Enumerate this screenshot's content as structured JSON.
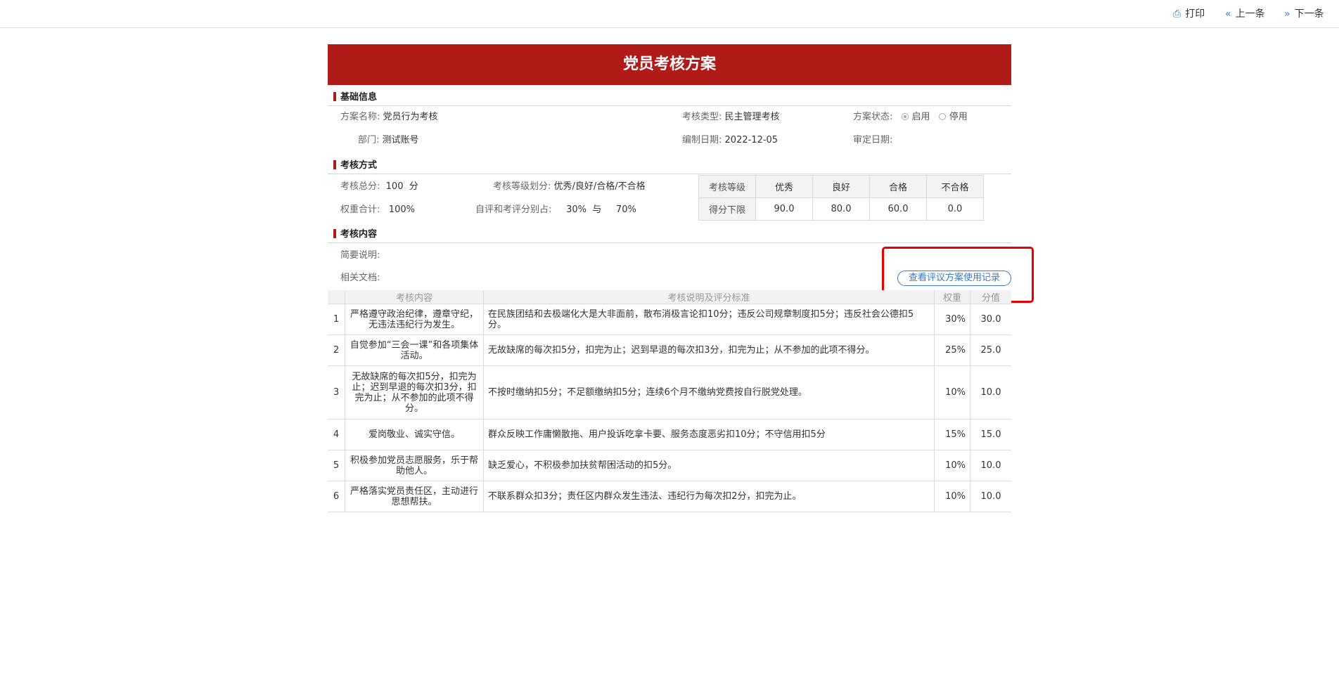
{
  "toolbar": {
    "print_label": "打印",
    "prev_label": "上一条",
    "next_label": "下一条"
  },
  "page": {
    "title": "党员考核方案"
  },
  "basic_info": {
    "section_title": "基础信息",
    "plan_name_label": "方案名称:",
    "plan_name": "党员行为考核",
    "assess_type_label": "考核类型:",
    "assess_type": "民主管理考核",
    "status_label": "方案状态:",
    "status_options": [
      "启用",
      "停用"
    ],
    "status_selected": "启用",
    "dept_label": "部门:",
    "dept": "测试账号",
    "compile_date_label": "编制日期:",
    "compile_date": "2022-12-05",
    "approve_date_label": "审定日期:",
    "approve_date": ""
  },
  "method": {
    "section_title": "考核方式",
    "total_label": "考核总分:",
    "total_value": "100",
    "total_unit": "分",
    "grade_split_label": "考核等级划分:",
    "grade_split": "优秀/良好/合格/不合格",
    "weight_sum_label": "权重合计:",
    "weight_sum": "100%",
    "ratio_label": "自评和考评分别占:",
    "self_ratio": "30%",
    "ratio_join": "与",
    "other_ratio": "70%",
    "grade_table": {
      "header_label": "考核等级",
      "grades": [
        "优秀",
        "良好",
        "合格",
        "不合格"
      ],
      "row_label": "得分下限",
      "thresholds": [
        "90.0",
        "80.0",
        "60.0",
        "0.0"
      ]
    }
  },
  "content": {
    "section_title": "考核内容",
    "summary_label": "简要说明:",
    "summary": "",
    "docs_label": "相关文档:",
    "record_button": "查看评议方案使用记录",
    "columns": [
      "",
      "考核内容",
      "考核说明及评分标准",
      "权重",
      "分值"
    ],
    "rows": [
      {
        "idx": "1",
        "item": "严格遵守政治纪律，遵章守纪，无违法违纪行为发生。",
        "desc": "在民族团结和去极端化大是大非面前，散布消极言论扣10分；违反公司规章制度扣5分；违反社会公德扣5分。",
        "weight": "30%",
        "score": "30.0"
      },
      {
        "idx": "2",
        "item": "自觉参加“三会一课”和各项集体活动。",
        "desc": "无故缺席的每次扣5分，扣完为止；迟到早退的每次扣3分，扣完为止；从不参加的此项不得分。",
        "weight": "25%",
        "score": "25.0"
      },
      {
        "idx": "3",
        "item": "无故缺席的每次扣5分，扣完为止；迟到早退的每次扣3分，扣完为止；从不参加的此项不得分。",
        "desc": "不按时缴纳扣5分；不足额缴纳扣5分；连续6个月不缴纳党费按自行脱党处理。",
        "weight": "10%",
        "score": "10.0"
      },
      {
        "idx": "4",
        "item": "爱岗敬业、诚实守信。",
        "desc": "群众反映工作庸懒散拖、用户投诉吃拿卡要、服务态度恶劣扣10分；不守信用扣5分",
        "weight": "15%",
        "score": "15.0"
      },
      {
        "idx": "5",
        "item": "积极参加党员志愿服务，乐于帮助他人。",
        "desc": "缺乏爱心，不积极参加扶贫帮困活动的扣5分。",
        "weight": "10%",
        "score": "10.0"
      },
      {
        "idx": "6",
        "item": "严格落实党员责任区，主动进行思想帮扶。",
        "desc": "不联系群众扣3分；责任区内群众发生违法、违纪行为每次扣2分，扣完为止。",
        "weight": "10%",
        "score": "10.0"
      }
    ]
  }
}
